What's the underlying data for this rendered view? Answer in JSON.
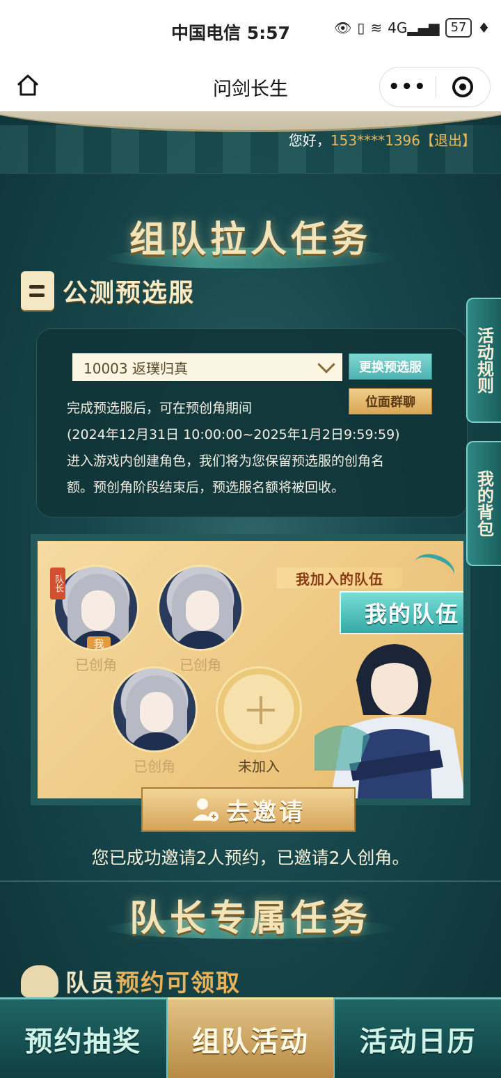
{
  "status_bar": {
    "carrier_time": "中国电信 5:57",
    "signal": "4G",
    "battery": "57"
  },
  "nav": {
    "title": "问剑长生",
    "more": "•••"
  },
  "header": {
    "greeting": "您好，",
    "phone": "153****1396",
    "logout": "【退出】"
  },
  "section1": {
    "title": "组队拉人任务",
    "subtitle": "公测预选服"
  },
  "server": {
    "selected": "10003 返璞归真",
    "change_button": "更换预选服",
    "group_chat_button": "位面群聊",
    "notice": [
      "完成预选服后，可在预创角期间",
      "(2024年12月31日 10:00:00~2025年1月2日9:59:59)",
      "进入游戏内创建角色，我们将为您保留预选服的创角名",
      "额。预创角阶段结束后，预选服名额将被回收。"
    ]
  },
  "team": {
    "joined_label": "我加入的队伍",
    "my_team_button": "我的队伍",
    "leader_tag": "队长",
    "me_badge": "我",
    "members": [
      {
        "status": "已创角"
      },
      {
        "status": "已创角"
      },
      {
        "status": "已创角"
      }
    ],
    "empty_status": "未加入"
  },
  "invite": {
    "button": "去邀请",
    "status": "您已成功邀请2人预约，已邀请2人创角。"
  },
  "section2": {
    "title": "队长专属任务",
    "member_task_prefix": "队员",
    "member_task_highlight": "预约可领取"
  },
  "side_tabs": {
    "rules": "活动规则",
    "bag": "我的背包"
  },
  "tabbar": {
    "lottery": "预约抽奖",
    "team": "组队活动",
    "calendar": "活动日历"
  },
  "colors": {
    "accent_gold": "#e9b75b",
    "teal": "#35aaa6",
    "background": "#17474b"
  }
}
